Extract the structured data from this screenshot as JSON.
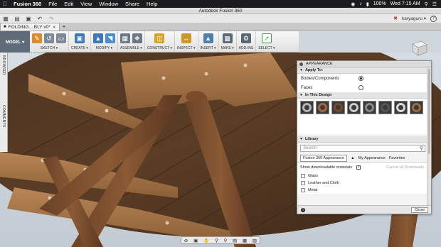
{
  "menubar": {
    "app": "Fusion 360",
    "items": [
      "File",
      "Edit",
      "View",
      "Window",
      "Share",
      "Help"
    ],
    "status": {
      "battery": "100%",
      "clock": "Wed 7:15 AM"
    }
  },
  "window": {
    "title": "Autodesk Fusion 360"
  },
  "qa": {
    "user": "karyaguru ▾",
    "help": "?"
  },
  "doc_tab": {
    "label": "FOLDING....BLY v0*"
  },
  "ribbon": {
    "workspace": "MODEL ▾",
    "groups": [
      {
        "label": "SKETCH ▾"
      },
      {
        "label": "CREATE ▾"
      },
      {
        "label": "MODIFY ▾"
      },
      {
        "label": "ASSEMBLE ▾"
      },
      {
        "label": "CONSTRUCT ▾"
      },
      {
        "label": "INSPECT ▾"
      },
      {
        "label": "INSERT ▾"
      },
      {
        "label": "MAKE ▾"
      },
      {
        "label": "ADD-INS"
      },
      {
        "label": "SELECT ▾"
      }
    ]
  },
  "sidebar": {
    "browser": "BROWSER",
    "comments": "COMMENTS"
  },
  "appearance": {
    "title": "APPEARANCE",
    "apply_to": {
      "label": "Apply To:",
      "options": [
        {
          "label": "Bodies/Components",
          "selected": true
        },
        {
          "label": "Faces",
          "selected": false
        }
      ]
    },
    "in_design": {
      "label": "In This Design",
      "swatch_count": 8
    },
    "library": {
      "label": "Library",
      "search_placeholder": "Search",
      "tabs": [
        "Fusion 360 Appearance",
        "My Appearance",
        "Favorites"
      ],
      "show_downloadable": "Show downloadable materials",
      "cancel_downloads": "Cancel all Downloads",
      "categories": [
        "Glass",
        "Leather and Cloth",
        "Metal"
      ]
    },
    "close": "Close"
  },
  "colors": {
    "wood_dark": "#5a3a22",
    "wood_light": "#a87a4f",
    "modelbar": "#5f6b78"
  }
}
